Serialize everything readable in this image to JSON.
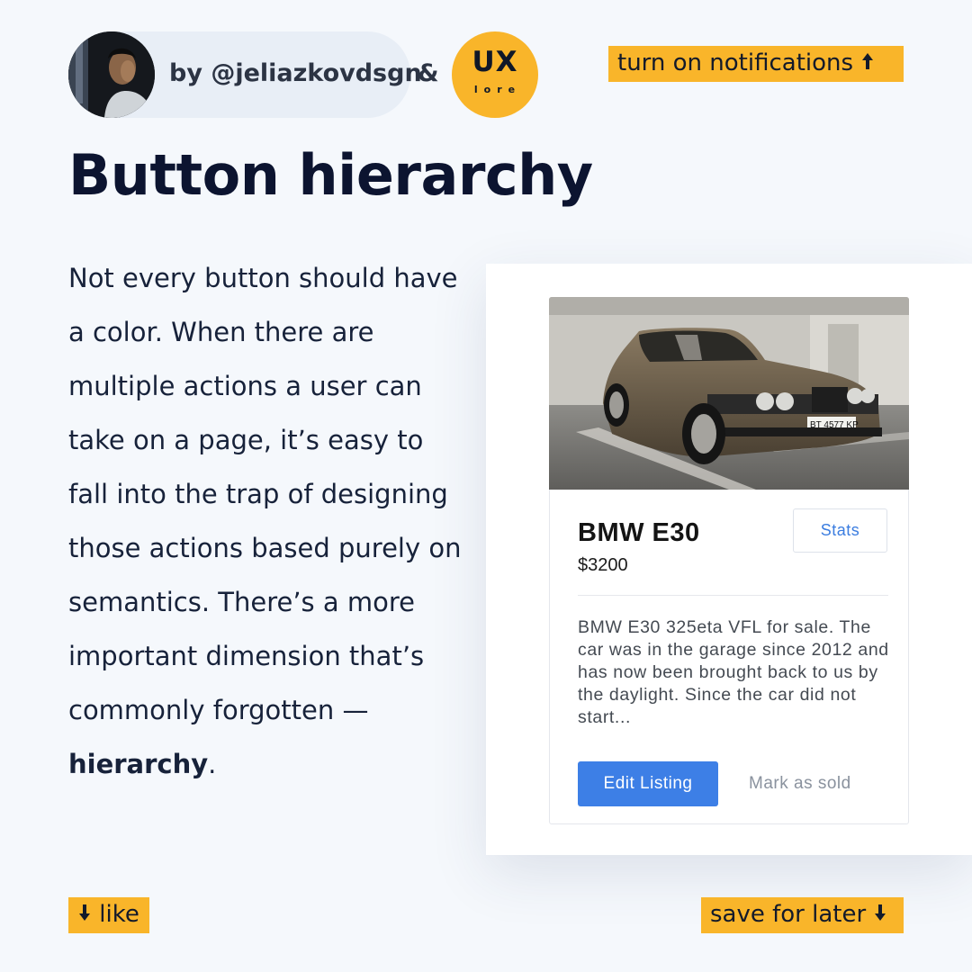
{
  "header": {
    "author": "by @jeliazkovdsgn",
    "ampersand": "&",
    "logo": {
      "main": "UX",
      "sub": "lore"
    },
    "notifications_label": "turn on notifications"
  },
  "title": "Button hierarchy",
  "body": {
    "text": "Not every button should have a color. When there are multiple actions a user can take on a page, it’s easy to fall into the trap of designing those actions based purely on semantics. There’s a more important dimension that’s commonly forgotten — ",
    "emphasis": "hierarchy",
    "end": "."
  },
  "card": {
    "car_name": "BMW E30",
    "price": "$3200",
    "stats_label": "Stats",
    "description": "BMW E30 325eta VFL for sale. The car was in the garage since 2012 and has now been brought back to us by the daylight. Since the car did not start...",
    "edit_label": "Edit Listing",
    "sold_label": "Mark as sold",
    "plate": "BT 4577 KP"
  },
  "footer": {
    "like_label": "like",
    "save_label": "save for later"
  },
  "icons": [
    "arrow-up-icon",
    "arrow-down-icon"
  ],
  "colors": {
    "accent_yellow": "#f9b52a",
    "primary_blue": "#3d7fe6",
    "title_navy": "#0c1430",
    "background": "#f5f8fc"
  }
}
